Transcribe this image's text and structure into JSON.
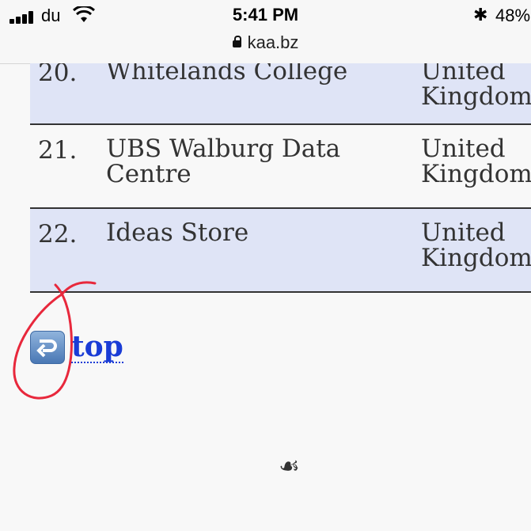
{
  "status_bar": {
    "carrier": "du",
    "time": "5:41 PM",
    "battery": "48%",
    "url": "kaa.bz"
  },
  "table": {
    "rows": [
      {
        "num": "20.",
        "name": "Whitelands College",
        "country": "United Kingdom"
      },
      {
        "num": "21.",
        "name": "UBS Walburg Data Centre",
        "country": "United Kingdom"
      },
      {
        "num": "22.",
        "name": "Ideas Store",
        "country": "United Kingdom"
      }
    ]
  },
  "top_link": {
    "label": "top",
    "icon": "return-arrow-icon"
  },
  "footer": {
    "ornament": "☙"
  },
  "colors": {
    "row_alt": "#dfe4f6",
    "link": "#1a3cd6",
    "annotation": "#e8283c"
  }
}
